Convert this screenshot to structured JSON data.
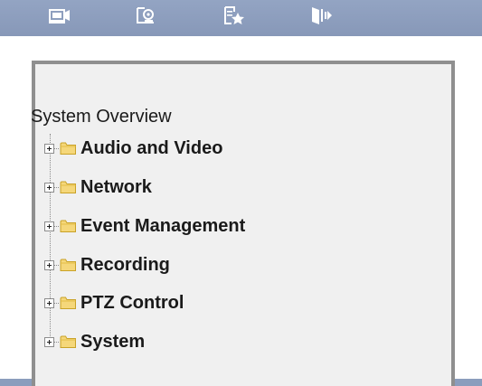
{
  "toolbar": {
    "buttons": [
      {
        "icon": "live-view-camera-icon"
      },
      {
        "icon": "playback-icon"
      },
      {
        "icon": "favorites-icon"
      },
      {
        "icon": "logout-icon"
      }
    ],
    "icon_color": "#ffffff"
  },
  "tree": {
    "root_label": "System Overview",
    "items": [
      {
        "label": "Audio and Video",
        "expander": "+",
        "icon": "folder-icon"
      },
      {
        "label": "Network",
        "expander": "+",
        "icon": "folder-icon"
      },
      {
        "label": "Event Management",
        "expander": "+",
        "icon": "folder-icon"
      },
      {
        "label": "Recording",
        "expander": "+",
        "icon": "folder-icon"
      },
      {
        "label": "PTZ Control",
        "expander": "+",
        "icon": "folder-icon"
      },
      {
        "label": "System",
        "expander": "+",
        "icon": "folder-icon"
      }
    ]
  },
  "colors": {
    "toolbar_bg": "#8b9dbd",
    "panel_bg": "#f0f0f0",
    "panel_border": "#8f8f8f",
    "folder_fill": "#f5d77a",
    "folder_stroke": "#c9a227",
    "text": "#1a1a1a"
  }
}
